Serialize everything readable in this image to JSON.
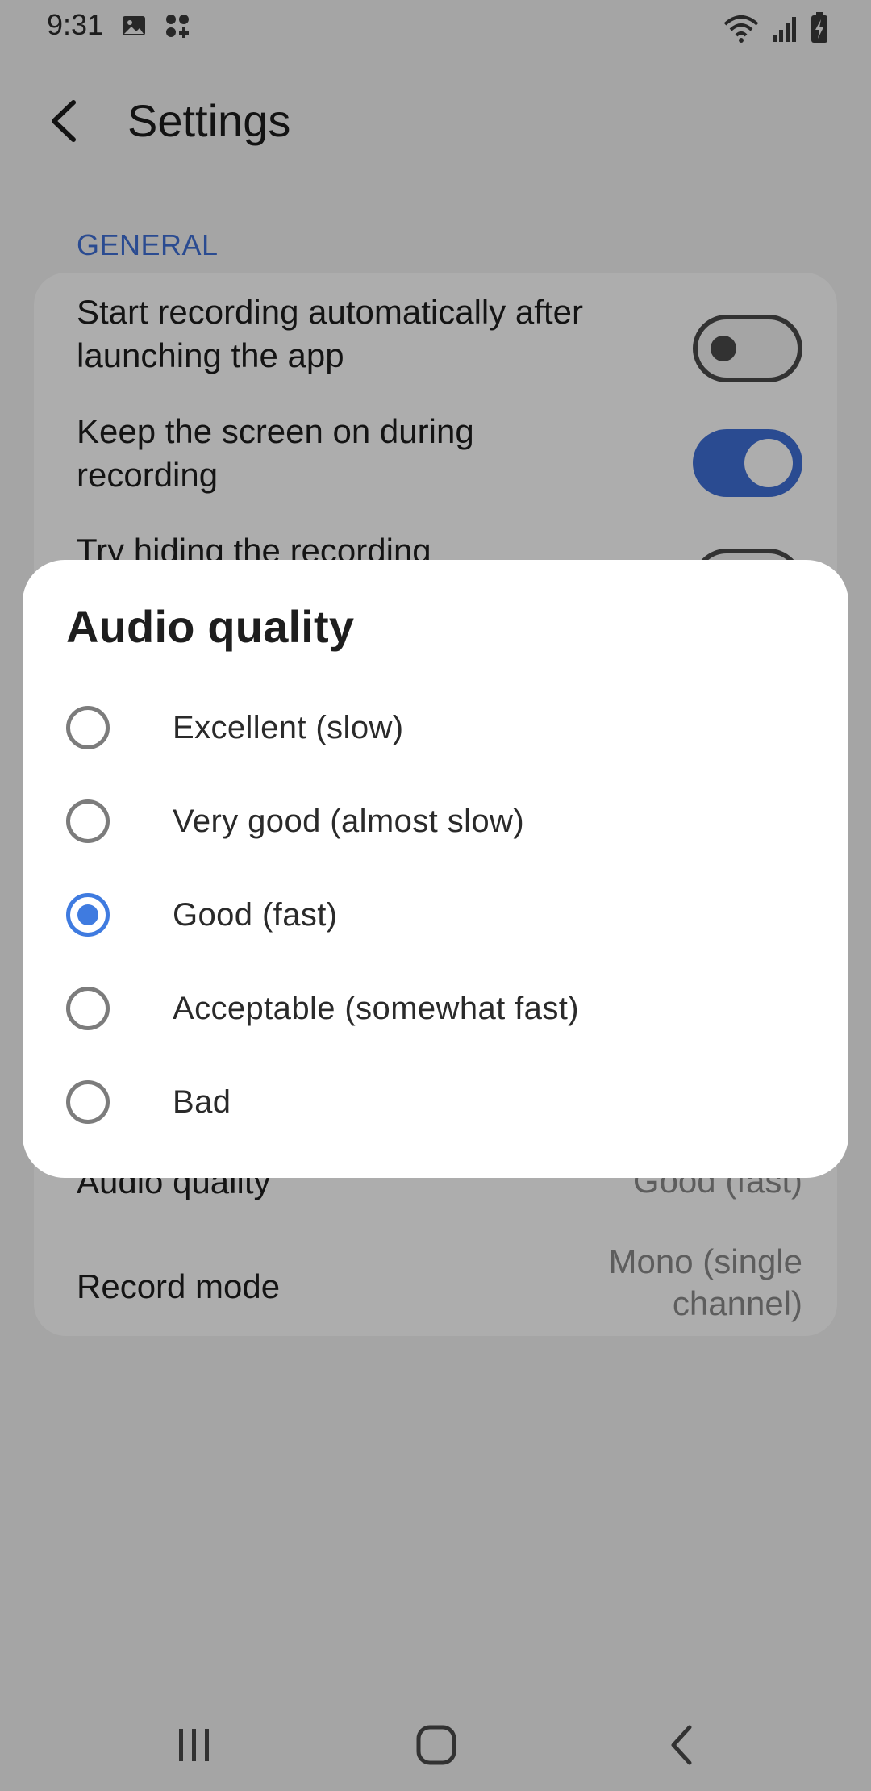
{
  "status_bar": {
    "time": "9:31",
    "left_icons": [
      "gallery-icon",
      "apps-icon"
    ],
    "right_icons": [
      "wifi-icon",
      "signal-icon",
      "battery-charging-icon"
    ]
  },
  "app_bar": {
    "back_icon": "chevron-left-icon",
    "title": "Settings"
  },
  "general": {
    "header": "GENERAL",
    "settings": [
      {
        "label": "Start recording automatically after launching the app",
        "toggle": false
      },
      {
        "label": "Keep the screen on during recording",
        "toggle": true
      },
      {
        "label": "Try hiding the recording",
        "toggle": false
      }
    ],
    "audio_quality": {
      "label": "Audio quality",
      "value": "Good (fast)"
    },
    "record_mode": {
      "label": "Record mode",
      "value": "Mono (single channel)"
    }
  },
  "dialog": {
    "title": "Audio quality",
    "options": [
      {
        "label": "Excellent (slow)",
        "selected": false
      },
      {
        "label": "Very good (almost slow)",
        "selected": false
      },
      {
        "label": "Good (fast)",
        "selected": true
      },
      {
        "label": "Acceptable (somewhat fast)",
        "selected": false
      },
      {
        "label": "Bad",
        "selected": false
      }
    ]
  },
  "nav_bar": {
    "icons": [
      "recent-apps-icon",
      "home-icon",
      "back-icon"
    ]
  },
  "colors": {
    "accent": "#3f6fd6",
    "radio_selected": "#3f7be0",
    "scrim": "rgba(0,0,0,0.32)"
  }
}
